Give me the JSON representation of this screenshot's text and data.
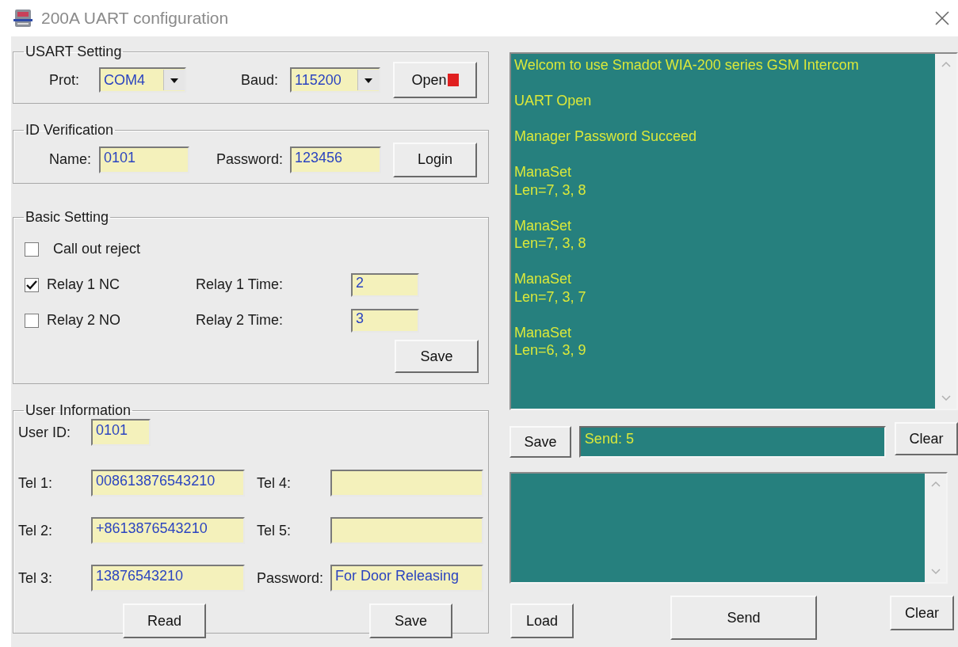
{
  "window": {
    "title": "200A UART configuration"
  },
  "usart_setting": {
    "title": "USART Setting",
    "port": {
      "label": "Prot:",
      "value": "COM4"
    },
    "baud": {
      "label": "Baud:",
      "value": "115200"
    },
    "button": "Open"
  },
  "id_verification": {
    "title": "ID Verification",
    "name": {
      "label": "Name:",
      "value": "0101"
    },
    "password": {
      "label": "Password:",
      "value": "123456"
    },
    "button": "Login"
  },
  "basic_setting": {
    "title": "Basic Setting",
    "options": [
      {
        "label": "Call out reject",
        "checked": false
      },
      {
        "label": "Relay 1 NC",
        "checked": true,
        "time_label": "Relay 1 Time:",
        "time_value": "2"
      },
      {
        "label": "Relay 2 NO",
        "checked": false,
        "time_label": "Relay 2 Time:",
        "time_value": "3"
      }
    ],
    "button": "Save"
  },
  "user_information": {
    "title": "User Information",
    "user_id": {
      "label": "User ID:",
      "value": "0101"
    },
    "fields": [
      {
        "label": "Tel 1:",
        "value": "008613876543210"
      },
      {
        "label": "Tel 4:"
      },
      {
        "label": "Tel 2:",
        "value": "+8613876543210"
      },
      {
        "label": "Tel 5:"
      },
      {
        "label": "Tel 3:",
        "value": "13876543210"
      },
      {
        "label": "Password:",
        "value": "For Door Releasing"
      }
    ],
    "buttons": [
      "Read",
      "Save"
    ]
  },
  "log": {
    "entries": [
      {
        "lines": [
          "Welcom to use Smadot WIA-200 series GSM Intercom"
        ]
      },
      {
        "lines": [
          "UART Open"
        ]
      },
      {
        "lines": [
          "Manager Password Succeed"
        ]
      },
      {
        "lines": [
          "ManaSet",
          "Len=7, 3, 8"
        ]
      },
      {
        "lines": [
          "ManaSet",
          "Len=7, 3, 8"
        ]
      },
      {
        "lines": [
          "ManaSet",
          "Len=7, 3, 7"
        ]
      },
      {
        "lines": [
          "ManaSet",
          "Len=6, 3, 9"
        ]
      }
    ]
  },
  "status_row": {
    "save_button": "Save",
    "value": "Send: 5",
    "clear_button": "Clear"
  },
  "send_row": {
    "load_button": "Load",
    "send_button": "Send",
    "clear_button": "Clear"
  }
}
